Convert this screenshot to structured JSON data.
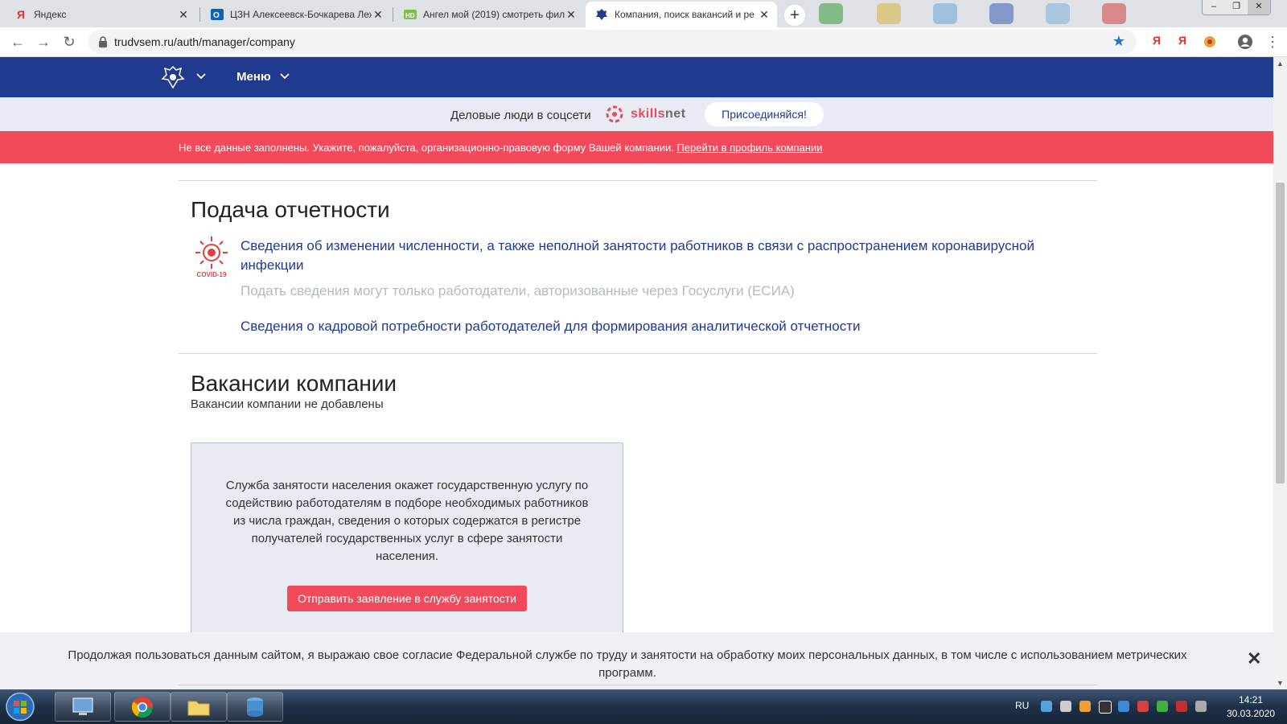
{
  "browser": {
    "tabs": [
      {
        "title": "Яндекс",
        "active": false
      },
      {
        "title": "ЦЗН Алексеевск-Бочкарева Леж",
        "active": false
      },
      {
        "title": "Ангел мой (2019) смотреть фил",
        "active": false
      },
      {
        "title": "Компания, поиск вакансий и ре",
        "active": true
      }
    ],
    "url": "trudvsem.ru/auth/manager/company",
    "extensions": [
      "Я",
      "Я"
    ]
  },
  "site": {
    "menu_label": "Меню",
    "promo": {
      "text": "Деловые люди в соцсети",
      "logo_part1": "skills",
      "logo_part2": "net",
      "join_label": "Присоединяйся!"
    },
    "alert": {
      "text": "Не все данные заполнены. Укажите, пожалуйста, организационно-правовую форму Вашей компании. ",
      "link": "Перейти в профиль компании"
    },
    "reports": {
      "heading": "Подача отчетности",
      "covid_badge": "COVID-19",
      "covid_link_line1": "Сведения об изменении численности, а также неполной занятости работников в связи с распространением коронавирусной",
      "covid_link_line2": "инфекции",
      "covid_note": "Подать сведения могут только работодатели, авторизованные через Госуслуги (ЕСИА)",
      "staff_link": "Сведения о кадровой потребности работодателей для формирования аналитической отчетности"
    },
    "vacancies": {
      "heading": "Вакансии компании",
      "empty_text": "Вакансии компании не добавлены",
      "card_text": "Служба занятости населения окажет государственную услугу по содействию работодателям в подборе необходимых работников из числа граждан, сведения о которых содержатся в регистре получателей государственных услуг в сфере занятости населения.",
      "card_button": "Отправить заявление в службу занятости"
    },
    "cookie": {
      "text": "Продолжая пользоваться данным сайтом, я выражаю свое согласие Федеральной службе по труду и занятости на обработку моих персональных данных, в том числе с использованием метрических программ."
    }
  },
  "taskbar": {
    "lang": "RU",
    "time": "14:21",
    "date": "30.03.2020"
  },
  "colors": {
    "nav_blue": "#1f3a8f",
    "alert_red": "#f24a5a",
    "link_blue": "#1f3a8f",
    "covid_red": "#e0403a"
  }
}
